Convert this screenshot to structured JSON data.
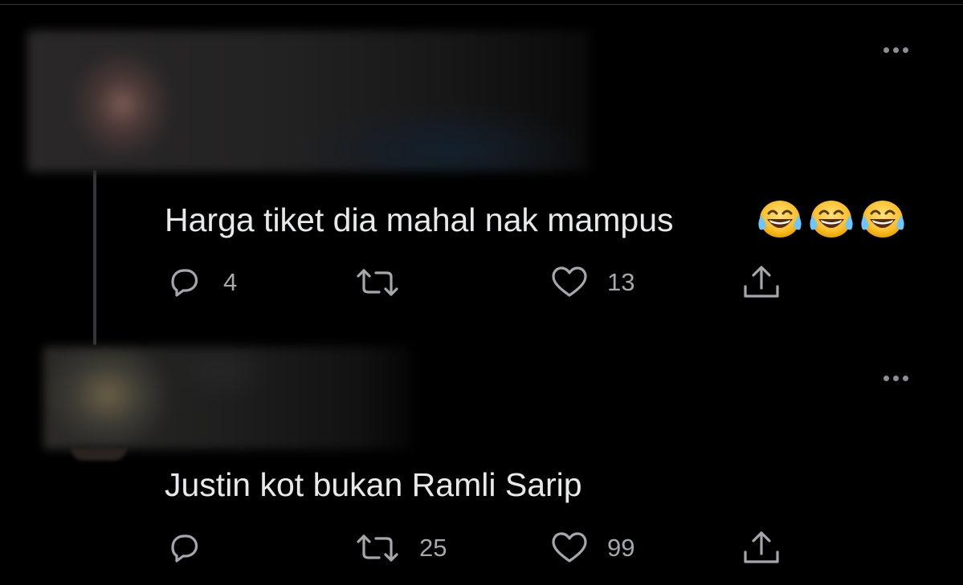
{
  "tweets": [
    {
      "text": "Harga tiket dia mahal nak mampus",
      "emojis": [
        "😂",
        "😂",
        "😂"
      ],
      "actions": {
        "reply_count": "4",
        "retweet_count": "",
        "like_count": "13"
      },
      "header_blurred": true
    },
    {
      "text": "Justin kot bukan Ramli Sarip",
      "actions": {
        "reply_count": "",
        "retweet_count": "25",
        "like_count": "99"
      },
      "header_blurred": true
    }
  ],
  "icons": {
    "reply": "reply-icon",
    "retweet": "retweet-icon",
    "like": "heart-icon",
    "share": "share-icon",
    "more": "more-options-icon",
    "emoji": "tears-of-joy-emoji"
  },
  "colors": {
    "background": "#000000",
    "text": "#e7e9ea",
    "icon": "#a4a8ad",
    "thread_line": "#333639"
  }
}
